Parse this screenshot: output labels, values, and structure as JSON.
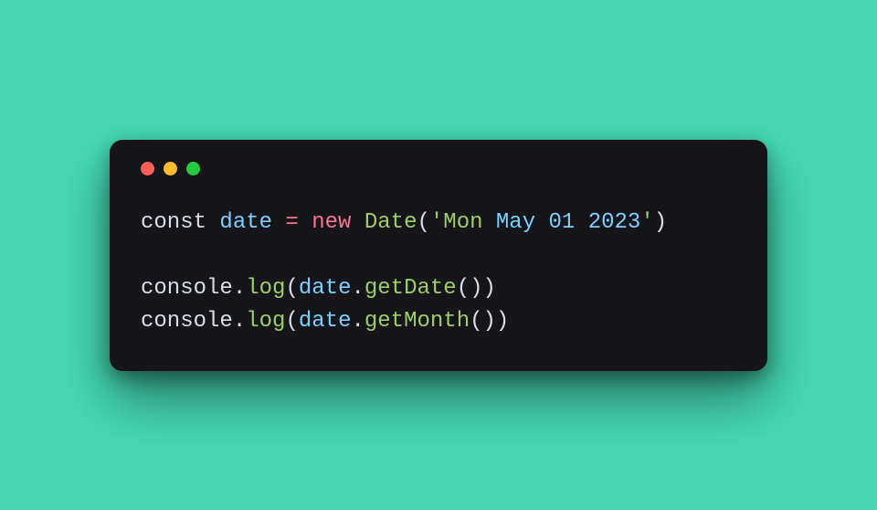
{
  "code": {
    "kw_const": "const",
    "var_date": "date",
    "op_assign": "=",
    "kw_new": "new",
    "class_date": "Date",
    "paren_open": "(",
    "paren_close": ")",
    "quote": "'",
    "date_string_pre": "Mon ",
    "date_string_em": "May 01 2023",
    "console": "console",
    "dot": ".",
    "log": "log",
    "getDate": "getDate",
    "getMonth": "getMonth"
  }
}
